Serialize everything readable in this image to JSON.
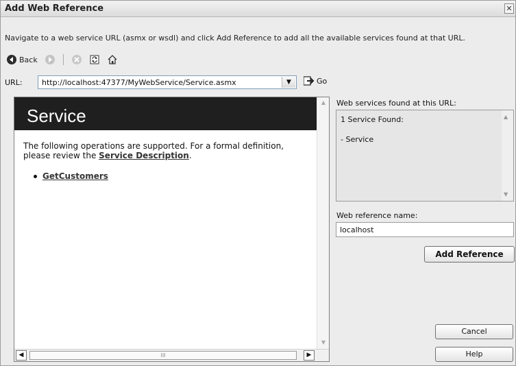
{
  "window": {
    "title": "Add Web Reference",
    "close_glyph": "✕"
  },
  "instruction": "Navigate to a web service URL (asmx or wsdl) and click Add Reference to add all the available services found at that URL.",
  "toolbar": {
    "back_label": "Back",
    "icons": [
      "back-icon",
      "forward-icon",
      "stop-icon",
      "refresh-icon",
      "home-icon"
    ]
  },
  "url_bar": {
    "label": "URL:",
    "value": "http://localhost:47377/MyWebService/Service.asmx",
    "go_label": "Go"
  },
  "browser": {
    "service_title": "Service",
    "description_prefix": "The following operations are supported. For a formal definition, please review the ",
    "description_link": "Service Description",
    "description_suffix": ".",
    "operations": [
      "GetCustomers"
    ],
    "hscroll_grip": "III"
  },
  "services_panel": {
    "label": "Web services found at this URL:",
    "count_text": "1 Service Found:",
    "items": [
      "- Service"
    ]
  },
  "reference_name": {
    "label": "Web reference name:",
    "value": "localhost"
  },
  "buttons": {
    "add_reference": "Add Reference",
    "cancel": "Cancel",
    "help": "Help"
  }
}
